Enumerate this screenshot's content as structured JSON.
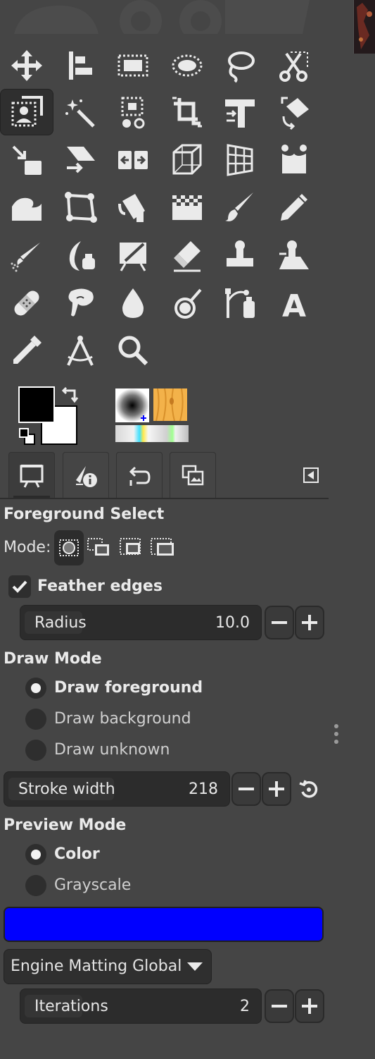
{
  "toolbox": {
    "tools": [
      {
        "icon": "move-icon"
      },
      {
        "icon": "align-icon"
      },
      {
        "icon": "rect-select-icon"
      },
      {
        "icon": "ellipse-select-icon"
      },
      {
        "icon": "free-select-icon"
      },
      {
        "icon": "scissors-select-icon"
      },
      {
        "icon": "foreground-select-icon",
        "active": true
      },
      {
        "icon": "fuzzy-select-icon"
      },
      {
        "icon": "select-by-color-icon"
      },
      {
        "icon": "crop-icon"
      },
      {
        "icon": "unified-transform-icon"
      },
      {
        "icon": "rotate-icon"
      },
      {
        "icon": "scale-icon"
      },
      {
        "icon": "shear-icon"
      },
      {
        "icon": "flip-icon"
      },
      {
        "icon": "perspective-icon"
      },
      {
        "icon": "3d-transform-icon"
      },
      {
        "icon": "handle-transform-icon"
      },
      {
        "icon": "warp-transform-icon"
      },
      {
        "icon": "cage-transform-icon"
      },
      {
        "icon": "bucket-fill-icon"
      },
      {
        "icon": "gradient-icon"
      },
      {
        "icon": "paintbrush-icon"
      },
      {
        "icon": "pencil-icon"
      },
      {
        "icon": "airbrush-icon"
      },
      {
        "icon": "ink-icon"
      },
      {
        "icon": "mypaint-brush-icon"
      },
      {
        "icon": "eraser-icon"
      },
      {
        "icon": "clone-icon"
      },
      {
        "icon": "perspective-clone-icon"
      },
      {
        "icon": "heal-icon"
      },
      {
        "icon": "smudge-icon"
      },
      {
        "icon": "blur-sharpen-icon"
      },
      {
        "icon": "dodge-burn-icon"
      },
      {
        "icon": "paths-icon"
      },
      {
        "icon": "text-icon"
      },
      {
        "icon": "color-picker-icon"
      },
      {
        "icon": "measure-icon"
      },
      {
        "icon": "zoom-icon"
      }
    ],
    "text_tool_glyph": "A"
  },
  "colors": {
    "foreground": "#000000",
    "background": "#ffffff",
    "brush_preview": "radial-brush-icon",
    "pattern_preview": "wood-pattern-icon",
    "gradient_preview": "gradient-strip-icon"
  },
  "tabs": [
    {
      "icon": "tool-options-icon",
      "active": true
    },
    {
      "icon": "device-status-icon"
    },
    {
      "icon": "undo-history-icon"
    },
    {
      "icon": "images-icon"
    }
  ],
  "options": {
    "title": "Foreground Select",
    "mode_label": "Mode:",
    "feather_edges_label": "Feather edges",
    "feather_edges_checked": true,
    "radius_label": "Radius",
    "radius_value": "10.0",
    "draw_mode_heading": "Draw Mode",
    "draw_modes": [
      {
        "label": "Draw foreground",
        "selected": true
      },
      {
        "label": "Draw background",
        "selected": false
      },
      {
        "label": "Draw unknown",
        "selected": false
      }
    ],
    "stroke_width_label": "Stroke width",
    "stroke_width_value": "218",
    "preview_mode_heading": "Preview Mode",
    "preview_modes": [
      {
        "label": "Color",
        "selected": true
      },
      {
        "label": "Grayscale",
        "selected": false
      }
    ],
    "preview_color": "#0000ff",
    "engine_value": "Engine Matting Global",
    "iterations_label": "Iterations",
    "iterations_value": "2"
  }
}
